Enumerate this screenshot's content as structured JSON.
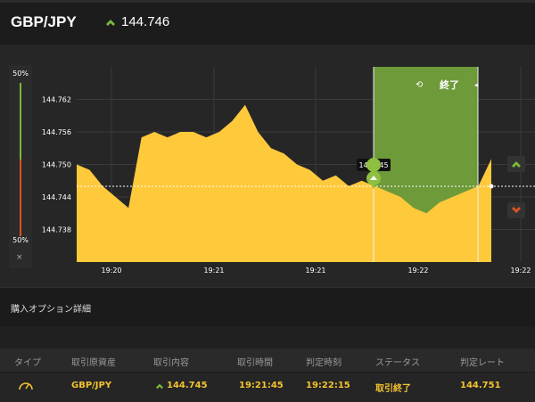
{
  "header": {
    "pair": "GBP/JPY",
    "rate": "144.746",
    "direction_icon": "up-arrow-icon"
  },
  "meter": {
    "top_label": "50%",
    "bottom_label": "50%",
    "close": "×"
  },
  "chart": {
    "y_ticks": [
      "144.762",
      "144.756",
      "144.750",
      "144.744",
      "144.738"
    ],
    "x_ticks": [
      "19:20",
      "19:21",
      "19:21",
      "19:22",
      "19:22"
    ],
    "entry_label": "144.745",
    "expiry_label": "終了",
    "colors": {
      "area": "#ffc93c",
      "window": "#6e9a3a",
      "up": "#7bb83a",
      "down": "#d9541e"
    }
  },
  "chart_data": {
    "type": "area",
    "x": [
      "19:19:45",
      "19:19:50",
      "19:19:55",
      "19:20:00",
      "19:20:05",
      "19:20:10",
      "19:20:15",
      "19:20:20",
      "19:20:25",
      "19:20:30",
      "19:20:35",
      "19:20:40",
      "19:20:45",
      "19:20:50",
      "19:20:55",
      "19:21:00",
      "19:21:05",
      "19:21:10",
      "19:21:15",
      "19:21:20",
      "19:21:25",
      "19:21:30",
      "19:21:35",
      "19:21:40",
      "19:21:45",
      "19:21:50",
      "19:21:55",
      "19:22:00",
      "19:22:05",
      "19:22:10",
      "19:22:15",
      "19:22:20",
      "19:22:25"
    ],
    "y": [
      144.75,
      144.749,
      144.746,
      144.744,
      144.742,
      144.755,
      144.756,
      144.755,
      144.756,
      144.756,
      144.755,
      144.756,
      144.758,
      144.761,
      144.756,
      144.753,
      144.752,
      144.75,
      144.749,
      144.747,
      144.748,
      144.746,
      144.747,
      144.746,
      144.745,
      144.744,
      144.742,
      144.741,
      144.743,
      144.744,
      144.745,
      144.746,
      144.751
    ],
    "y_ticks": [
      144.738,
      144.744,
      144.75,
      144.756,
      144.762
    ],
    "x_tick_labels": [
      "19:20",
      "19:21",
      "19:21",
      "19:22",
      "19:22"
    ],
    "entry_rate": 144.745,
    "current_rate": 144.746
  },
  "section": {
    "title": "購入オプション詳細"
  },
  "table": {
    "headers": [
      "タイプ",
      "取引原資産",
      "取引内容",
      "取引時間",
      "判定時刻",
      "ステータス",
      "判定レート"
    ],
    "row": {
      "type_icon": "gauge-icon",
      "asset": "GBP/JPY",
      "content": "144.745",
      "trade_time": "19:21:45",
      "judge_time": "19:22:15",
      "status": "取引終了",
      "judge_rate": "144.751"
    }
  }
}
